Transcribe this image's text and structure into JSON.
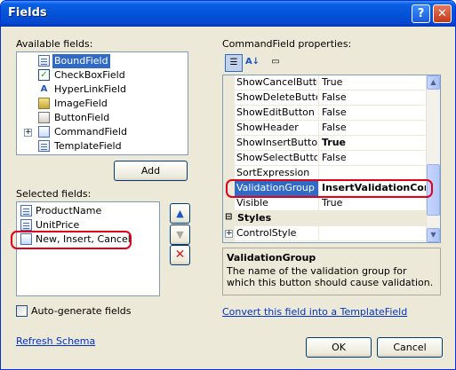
{
  "window": {
    "title": "Fields",
    "help_glyph": "?",
    "close_glyph": "✕"
  },
  "available": {
    "label": "Available fields:",
    "items": [
      {
        "label": "BoundField",
        "icon": "bound-field-icon",
        "selected": true
      },
      {
        "label": "CheckBoxField",
        "icon": "checkbox-field-icon"
      },
      {
        "label": "HyperLinkField",
        "icon": "hyperlink-field-icon"
      },
      {
        "label": "ImageField",
        "icon": "image-field-icon"
      },
      {
        "label": "ButtonField",
        "icon": "button-field-icon"
      },
      {
        "label": "CommandField",
        "icon": "command-field-icon",
        "expandable": true
      },
      {
        "label": "TemplateField",
        "icon": "template-field-icon"
      }
    ],
    "add_label": "Add"
  },
  "selected": {
    "label": "Selected fields:",
    "items": [
      {
        "label": "ProductName",
        "icon": "bound-field-icon"
      },
      {
        "label": "UnitPrice",
        "icon": "bound-field-icon"
      },
      {
        "label": "New, Insert, Cancel",
        "icon": "command-field-icon",
        "selected": true
      }
    ],
    "move_up_icon": "arrow-up-icon",
    "move_down_icon": "arrow-down-icon",
    "delete_icon": "delete-x-icon"
  },
  "properties": {
    "label": "CommandField properties:",
    "toolbar": {
      "categorized_icon": "categorized-icon",
      "alphabetical_icon": "alphabetical-icon",
      "pages_icon": "property-pages-icon"
    },
    "rows": [
      {
        "name": "ShowCancelButton",
        "value": "True"
      },
      {
        "name": "ShowDeleteButton",
        "value": "False"
      },
      {
        "name": "ShowEditButton",
        "value": "False"
      },
      {
        "name": "ShowHeader",
        "value": "False"
      },
      {
        "name": "ShowInsertButton",
        "value": "True",
        "bold": true
      },
      {
        "name": "ShowSelectButton",
        "value": "False"
      },
      {
        "name": "SortExpression",
        "value": ""
      },
      {
        "name": "ValidationGroup",
        "value": "InsertValidationCont",
        "selected": true,
        "bold": true
      },
      {
        "name": "Visible",
        "value": "True"
      }
    ],
    "category": {
      "name": "Styles",
      "toggle": "⊟"
    },
    "subrow": {
      "name": "ControlStyle",
      "toggle": "+"
    },
    "description": {
      "title": "ValidationGroup",
      "text": "The name of the validation group for which this button should cause validation."
    }
  },
  "auto_generate": {
    "label": "Auto-generate fields",
    "checked": false
  },
  "convert_link": "Convert this field into a TemplateField",
  "refresh_link": "Refresh Schema",
  "ok_label": "OK",
  "cancel_label": "Cancel",
  "colors": {
    "titlebar": "#0a5fe4",
    "selection": "#316ac5",
    "highlight_ring": "#e0001a",
    "dialog_bg": "#ece9d8"
  }
}
